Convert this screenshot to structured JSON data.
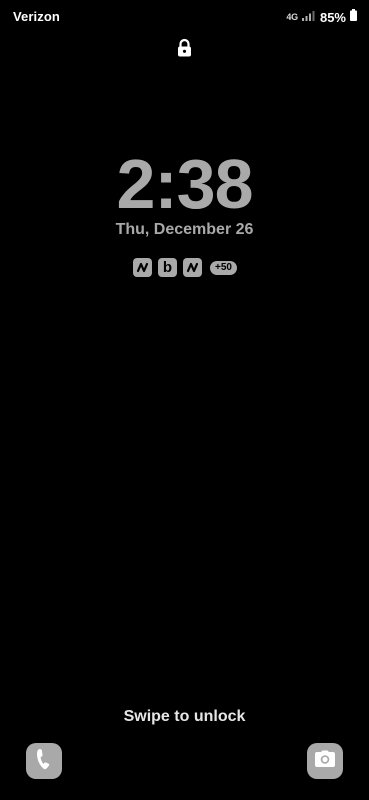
{
  "status_bar": {
    "carrier": "Verizon",
    "network_type": "4G",
    "battery_percent": "85%",
    "icons": [
      "signal-icon",
      "battery-icon"
    ]
  },
  "lock_screen": {
    "lock_icon": "lock-icon",
    "time": "2:38",
    "date": "Thu, December 26",
    "notifications": {
      "apps": [
        {
          "icon": "news-app-icon"
        },
        {
          "icon": "b-app-icon",
          "letter": "b"
        },
        {
          "icon": "news-app-icon"
        }
      ],
      "more_count": "+50"
    },
    "swipe_hint": "Swipe to unlock",
    "shortcuts": {
      "left": "phone-icon",
      "right": "camera-icon"
    }
  },
  "colors": {
    "background": "#000000",
    "clock": "#a9a9a9",
    "text": "#ffffff"
  }
}
